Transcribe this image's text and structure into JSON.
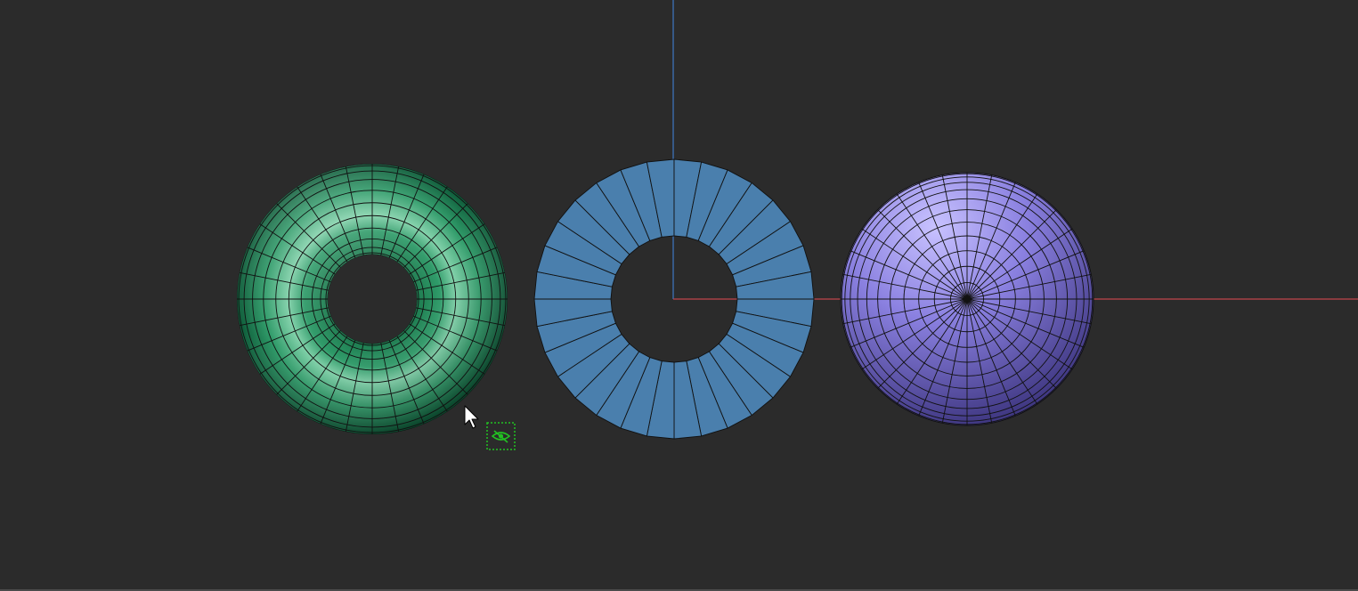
{
  "viewport": {
    "background_color": "#2b2b2b",
    "x_axis_color": "#c0454b",
    "z_axis_color": "#3e78c4",
    "wire_color": "#111111",
    "cursor_icon": "arrow-cursor-icon",
    "hide_indicator_icon": "eye-slash-icon",
    "hide_indicator_color": "#22c222"
  },
  "objects": [
    {
      "name": "torus",
      "shading": "smooth",
      "base_color": "#2e9a68",
      "light_color": "#7fd0a8",
      "dark_color": "#0d5a38",
      "ring_segments": 32,
      "radial_bands": 11
    },
    {
      "name": "annulus",
      "shading": "flat",
      "base_color": "#4a7fad",
      "segments": 32
    },
    {
      "name": "uv-sphere",
      "shading": "smooth",
      "base_color": "#8a80e0",
      "light_color": "#c8c2ff",
      "dark_color": "#3e3680",
      "meridians": 32,
      "rings": 11
    }
  ]
}
